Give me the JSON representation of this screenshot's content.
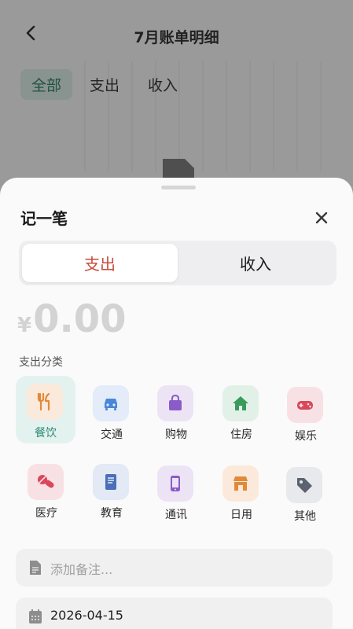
{
  "background": {
    "title": "7月账单明细",
    "filter_tabs": [
      "全部",
      "支出",
      "收入"
    ],
    "active_filter": "全部"
  },
  "sheet": {
    "title": "记一笔",
    "type_tabs": {
      "expense": "支出",
      "income": "收入",
      "selected": "expense"
    },
    "amount": {
      "currency": "¥",
      "value": "0.00"
    },
    "category_label": "支出分类",
    "categories": [
      {
        "name": "餐饮",
        "icon": "utensils-icon",
        "color": "#e08a3a",
        "bg": "#fbeadb",
        "selected": true
      },
      {
        "name": "交通",
        "icon": "car-icon",
        "color": "#4a86d9",
        "bg": "#e3ecf8"
      },
      {
        "name": "购物",
        "icon": "shopping-bag-icon",
        "color": "#8a5cc8",
        "bg": "#ece4f5"
      },
      {
        "name": "住房",
        "icon": "home-icon",
        "color": "#3a9a5c",
        "bg": "#e2f1e7"
      },
      {
        "name": "娱乐",
        "icon": "gamepad-icon",
        "color": "#d9485a",
        "bg": "#f8e1e4"
      },
      {
        "name": "医疗",
        "icon": "pill-icon",
        "color": "#d9485a",
        "bg": "#f8e1e4"
      },
      {
        "name": "教育",
        "icon": "book-icon",
        "color": "#4a6fb8",
        "bg": "#e3e9f5"
      },
      {
        "name": "通讯",
        "icon": "phone-icon",
        "color": "#8a5cc8",
        "bg": "#ece4f5"
      },
      {
        "name": "日用",
        "icon": "store-icon",
        "color": "#e08a3a",
        "bg": "#fbeadb"
      },
      {
        "name": "其他",
        "icon": "tag-icon",
        "color": "#5b6270",
        "bg": "#e8e9ec"
      }
    ],
    "note": {
      "placeholder": "添加备注..."
    },
    "date": {
      "value": "2026-04-15"
    }
  }
}
